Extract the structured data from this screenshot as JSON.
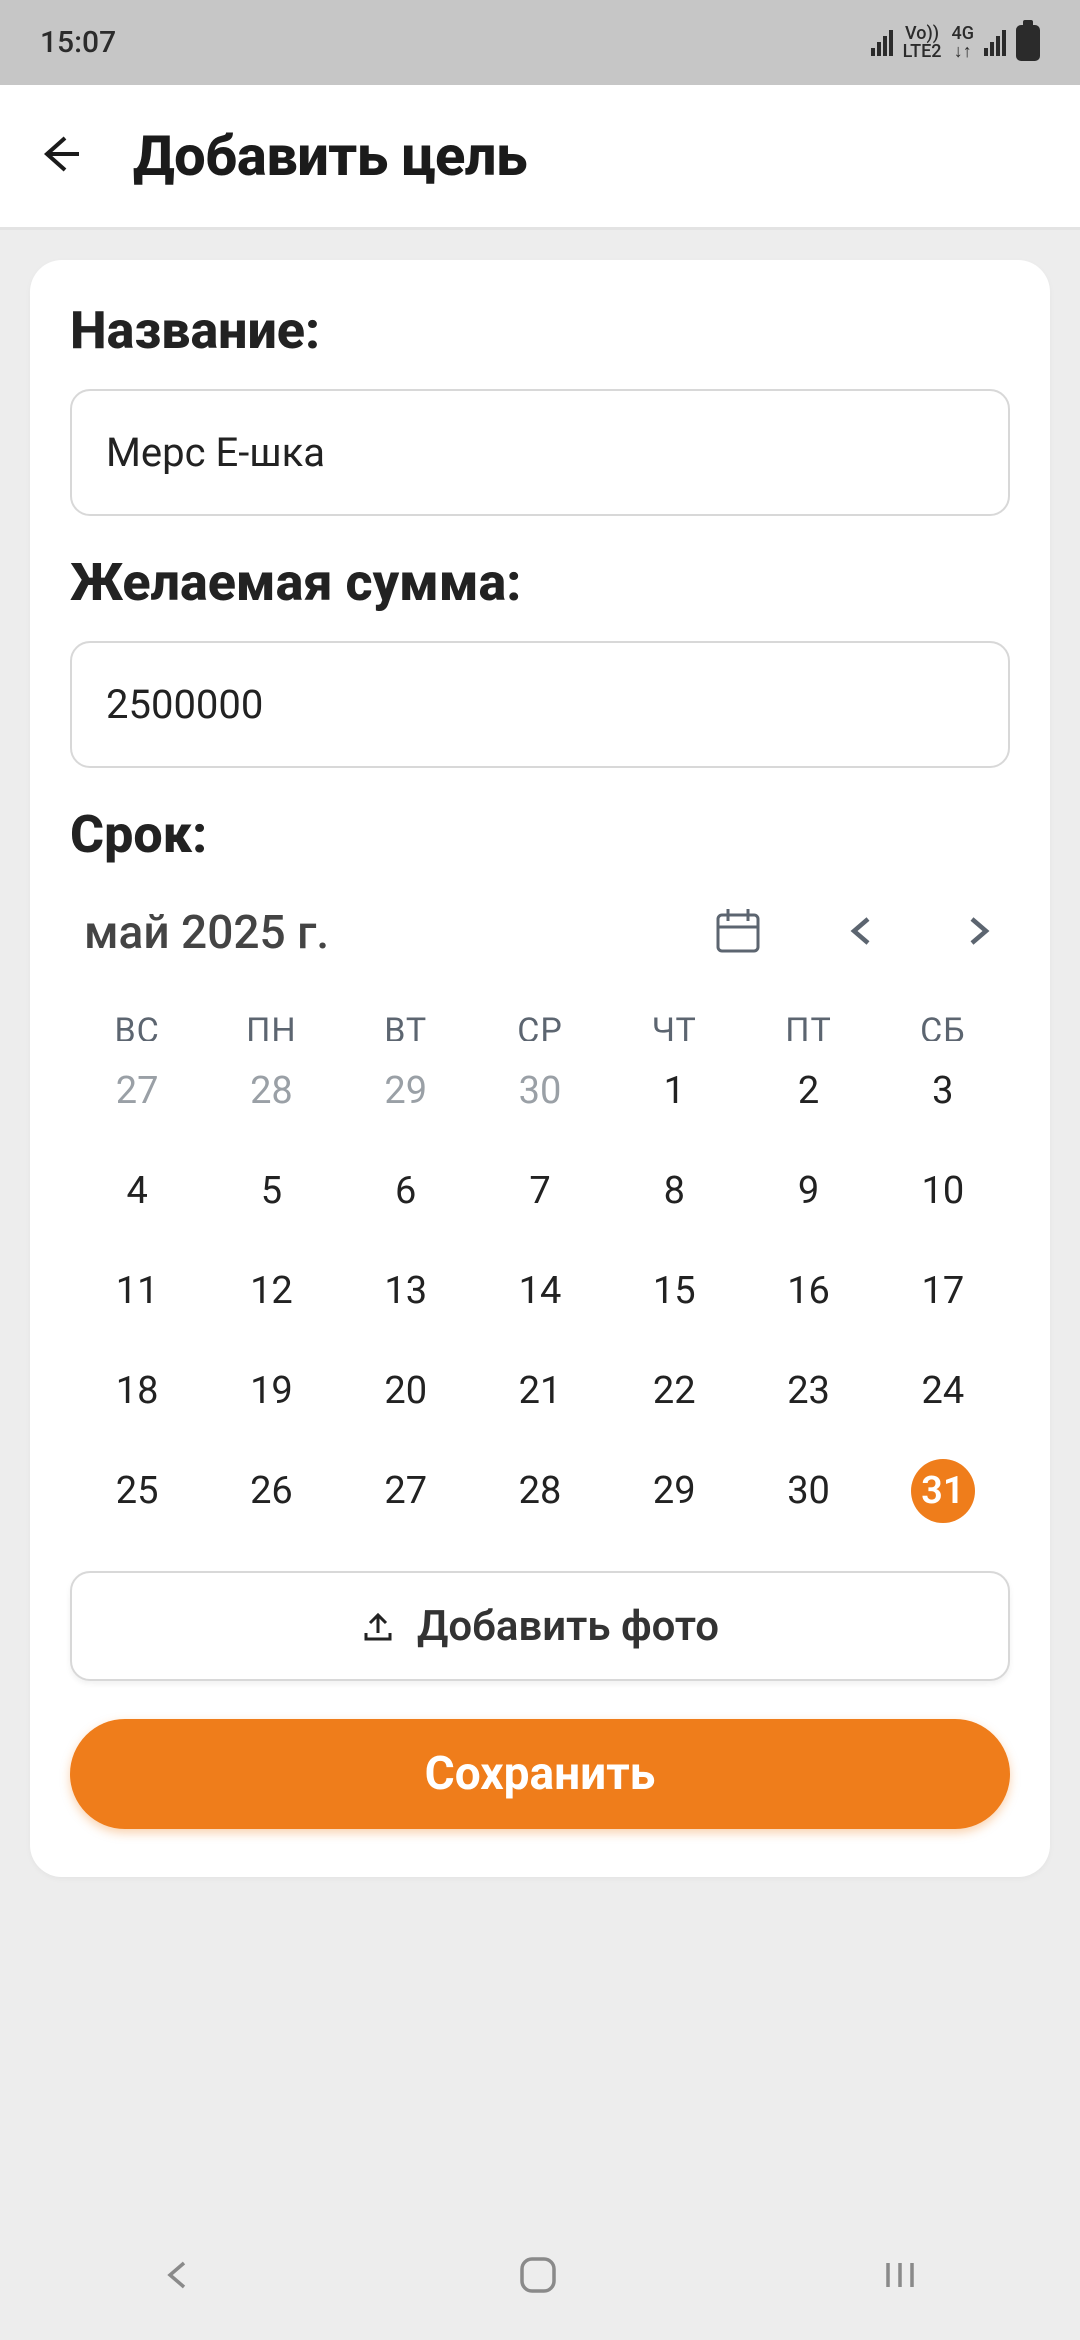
{
  "status": {
    "time": "15:07",
    "net1": "Vo))",
    "net2": "LTE2",
    "net3": "4G"
  },
  "header": {
    "title": "Добавить цель"
  },
  "form": {
    "name_label": "Название:",
    "name_value": "Мерс Е-шка",
    "amount_label": "Желаемая сумма:",
    "amount_value": "2500000",
    "deadline_label": "Срок:"
  },
  "calendar": {
    "month_label": "май 2025 г.",
    "weekdays": [
      "ВС",
      "ПН",
      "ВТ",
      "СР",
      "ЧТ",
      "ПТ",
      "СБ"
    ],
    "cells": [
      {
        "d": "27",
        "dim": true
      },
      {
        "d": "28",
        "dim": true
      },
      {
        "d": "29",
        "dim": true
      },
      {
        "d": "30",
        "dim": true
      },
      {
        "d": "1"
      },
      {
        "d": "2"
      },
      {
        "d": "3"
      },
      {
        "d": "4"
      },
      {
        "d": "5"
      },
      {
        "d": "6"
      },
      {
        "d": "7"
      },
      {
        "d": "8"
      },
      {
        "d": "9"
      },
      {
        "d": "10"
      },
      {
        "d": "11"
      },
      {
        "d": "12"
      },
      {
        "d": "13"
      },
      {
        "d": "14"
      },
      {
        "d": "15"
      },
      {
        "d": "16"
      },
      {
        "d": "17"
      },
      {
        "d": "18"
      },
      {
        "d": "19"
      },
      {
        "d": "20"
      },
      {
        "d": "21"
      },
      {
        "d": "22"
      },
      {
        "d": "23"
      },
      {
        "d": "24"
      },
      {
        "d": "25"
      },
      {
        "d": "26"
      },
      {
        "d": "27"
      },
      {
        "d": "28"
      },
      {
        "d": "29"
      },
      {
        "d": "30"
      },
      {
        "d": "31",
        "sel": true
      }
    ]
  },
  "buttons": {
    "add_photo": "Добавить фото",
    "save": "Сохранить"
  },
  "colors": {
    "accent": "#ef7d1b"
  }
}
